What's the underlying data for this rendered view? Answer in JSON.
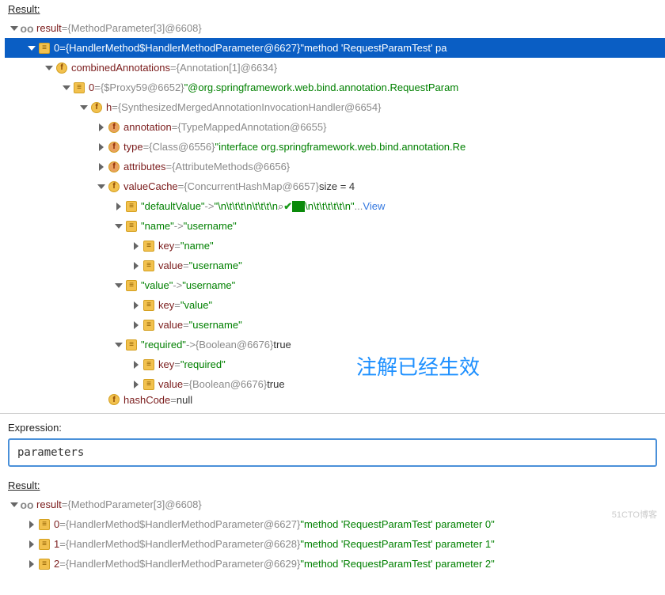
{
  "top": {
    "label": "Result:",
    "root": {
      "name": "result",
      "type": "{MethodParameter[3]@6608}"
    },
    "selected": {
      "name": "0",
      "type": "{HandlerMethod$HandlerMethodParameter@6627}",
      "value": "\"method 'RequestParamTest' pa"
    },
    "combined": {
      "name": "combinedAnnotations",
      "type": "{Annotation[1]@6634}"
    },
    "proxy": {
      "name": "0",
      "type": "{$Proxy59@6652}",
      "value": "\"@org.springframework.web.bind.annotation.RequestParam"
    },
    "h": {
      "name": "h",
      "type": "{SynthesizedMergedAnnotationInvocationHandler@6654}"
    },
    "annotation": {
      "name": "annotation",
      "type": "{TypeMappedAnnotation@6655}"
    },
    "typeField": {
      "name": "type",
      "type": "{Class@6556}",
      "value": "\"interface org.springframework.web.bind.annotation.Re"
    },
    "attributes": {
      "name": "attributes",
      "type": "{AttributeMethods@6656}"
    },
    "valueCache": {
      "name": "valueCache",
      "type": "{ConcurrentHashMap@6657}",
      "size": "size = 4"
    },
    "defaultValue": {
      "key": "\"defaultValue\"",
      "arrow": "->",
      "val1": "\"\\n\\t\\t\\t\\n\\t\\t\\t\\n",
      "val2": "\\n\\t\\t\\t\\t\\t\\n\"",
      "dots": "...",
      "view": "View"
    },
    "nameEntry": {
      "key": "\"name\"",
      "arrow": "->",
      "val": "\"username\"",
      "k_label": "key",
      "k_val": "\"name\"",
      "v_label": "value",
      "v_val": "\"username\""
    },
    "valueEntry": {
      "key": "\"value\"",
      "arrow": "->",
      "val": "\"username\"",
      "k_label": "key",
      "k_val": "\"value\"",
      "v_label": "value",
      "v_val": "\"username\""
    },
    "requiredEntry": {
      "key": "\"required\"",
      "arrow": "->",
      "type": "{Boolean@6676}",
      "val": "true",
      "k_label": "key",
      "k_val": "\"required\"",
      "v_label": "value",
      "v_type": "{Boolean@6676}",
      "v_val": "true"
    },
    "hashCode": {
      "name": "hashCode",
      "eq": "=",
      "val": "null"
    }
  },
  "overlay_text": "注解已经生效",
  "expression": {
    "label": "Expression:",
    "value": "parameters"
  },
  "bottom": {
    "label": "Result:",
    "root": {
      "name": "result",
      "type": "{MethodParameter[3]@6608}"
    },
    "items": [
      {
        "name": "0",
        "type": "{HandlerMethod$HandlerMethodParameter@6627}",
        "value": "\"method 'RequestParamTest' parameter 0\""
      },
      {
        "name": "1",
        "type": "{HandlerMethod$HandlerMethodParameter@6628}",
        "value": "\"method 'RequestParamTest' parameter 1\""
      },
      {
        "name": "2",
        "type": "{HandlerMethod$HandlerMethodParameter@6629}",
        "value": "\"method 'RequestParamTest' parameter 2\""
      }
    ]
  },
  "watermark": "51CTO博客"
}
